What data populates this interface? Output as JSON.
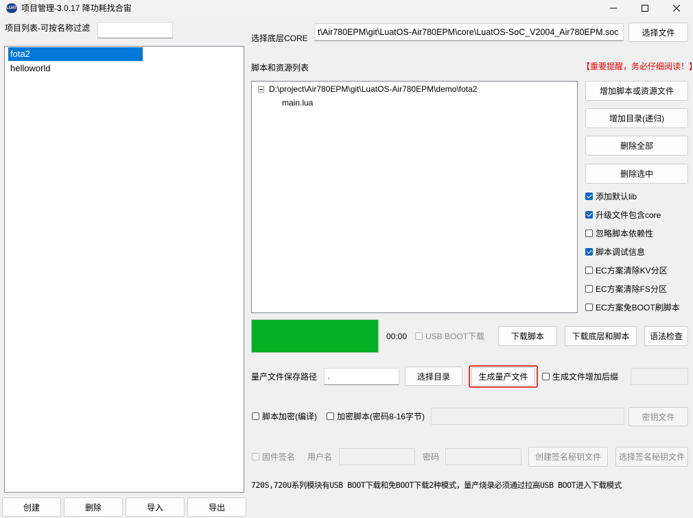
{
  "window": {
    "title": "项目管理-3.0.17 降功耗找合宙",
    "icon": "luatos-logo-icon",
    "controls": [
      "minimize-icon",
      "maximize-icon",
      "close-icon"
    ]
  },
  "left": {
    "filter_label": "项目列表-可按名称过滤",
    "filter_value": "",
    "projects": [
      "fota2",
      "helloworld"
    ],
    "selected_index": 0,
    "buttons": {
      "create": "创建",
      "delete": "删除",
      "import": "导入",
      "export": "导出"
    }
  },
  "core": {
    "label": "选择底层CORE",
    "path": "t\\Air780EPM\\git\\LuatOS-Air780EPM\\core\\LuatOS-SoC_V2004_Air780EPM.soc",
    "select_button": "选择文件"
  },
  "scripts": {
    "label": "脚本和资源列表",
    "warning": "【重要提醒，务必仔细阅读！】",
    "tree": {
      "root": "D:\\project\\Air780EPM\\git\\LuatOS-Air780EPM\\demo\\fota2",
      "children": [
        "main.lua"
      ]
    },
    "buttons": {
      "add_file": "增加脚本或资源文件",
      "add_dir": "增加目录(递归)",
      "delete_all": "删除全部",
      "delete_selected": "删除选中"
    },
    "options": [
      {
        "label": "添加默认lib",
        "checked": true
      },
      {
        "label": "升级文件包含core",
        "checked": true
      },
      {
        "label": "忽略脚本依赖性",
        "checked": false
      },
      {
        "label": "脚本调试信息",
        "checked": true
      },
      {
        "label": "EC方案清除KV分区",
        "checked": false
      },
      {
        "label": "EC方案清除FS分区",
        "checked": false
      },
      {
        "label": "EC方案免BOOT刷脚本",
        "checked": false
      }
    ]
  },
  "download": {
    "progress": 1.0,
    "progress_color": "#06b025",
    "time": "00:00",
    "usb_boot_label": "USB BOOT下载",
    "usb_boot_checked": false,
    "buttons": {
      "download_script": "下载脚本",
      "download_core_script": "下载底层和脚本",
      "syntax_check": "语法检查"
    }
  },
  "mass": {
    "path_label": "量产文件保存路径",
    "path_value": ".",
    "select_dir": "选择目录",
    "generate": "生成量产文件",
    "suffix_label": "生成文件增加后缀",
    "suffix_checked": false,
    "suffix_value": ""
  },
  "encrypt": {
    "compile_label": "脚本加密(编译)",
    "compile_checked": false,
    "encrypt_label": "加密脚本(密码8-16字节)",
    "encrypt_checked": false,
    "password_value": "",
    "key_file_button": "密钥文件"
  },
  "sign": {
    "firmware_sign_label": "固件签名",
    "username_label": "用户名",
    "username_value": "",
    "password_label": "密码",
    "password_value": "",
    "create_key_button": "创建签名秘钥文件",
    "select_key_button": "选择签名秘钥文件"
  },
  "footer_note": "720S,720U系列模块有USB BOOT下载和免BOOT下载2种模式，量产烧录必须通过拉高USB BOOT进入下载模式",
  "accent_colors": {
    "selection": "#0078d7",
    "warning": "#e60000",
    "highlight_border": "#e53935",
    "checkbox": "#1565c0"
  }
}
